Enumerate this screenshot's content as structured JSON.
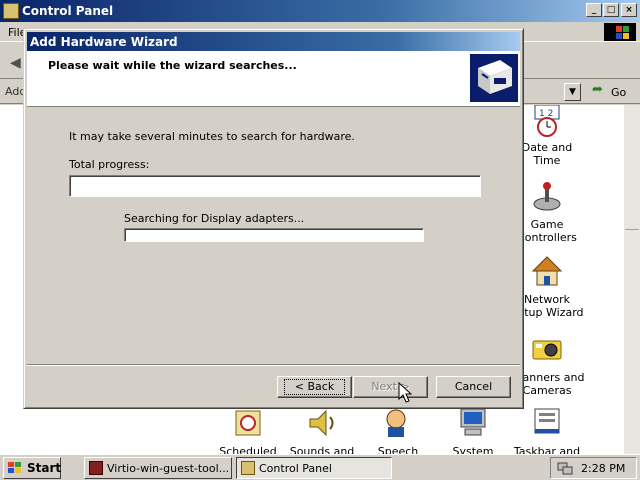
{
  "window": {
    "title": "Control Panel",
    "menu_first": "File",
    "address_label": "Address",
    "go_label": "Go",
    "icons": [
      {
        "label": "Date and Time",
        "icon": "clock-calendar-icon"
      },
      {
        "label": "Game Controllers",
        "icon": "joystick-icon"
      },
      {
        "label": "Network Setup Wizard",
        "icon": "network-house-icon"
      },
      {
        "label": "Scanners and Cameras",
        "icon": "camera-icon"
      },
      {
        "label": "Scheduled",
        "icon": "scheduled-tasks-icon"
      },
      {
        "label": "Sounds and",
        "icon": "speaker-icon"
      },
      {
        "label": "Speech",
        "icon": "speech-icon"
      },
      {
        "label": "System",
        "icon": "computer-icon"
      },
      {
        "label": "Taskbar and",
        "icon": "taskbar-icon"
      }
    ]
  },
  "wizard": {
    "title": "Add Hardware Wizard",
    "heading": "Please wait while the wizard searches...",
    "description": "It may take several minutes to search for hardware.",
    "total_progress_label": "Total progress:",
    "total_progress": 0,
    "searching_label": "Searching for Display adapters...",
    "searching_progress": 0,
    "buttons": {
      "back": "< Back",
      "next": "Next >",
      "cancel": "Cancel"
    }
  },
  "taskbar": {
    "start_label": "Start",
    "tasks": [
      {
        "label": "Virtio-win-guest-tool..."
      },
      {
        "label": "Control Panel",
        "active": true
      }
    ],
    "clock": "2:28 PM"
  },
  "colors": {
    "title_active": "#0a246a",
    "title_gradient_end": "#a6caf0",
    "face": "#d4d0c8"
  }
}
